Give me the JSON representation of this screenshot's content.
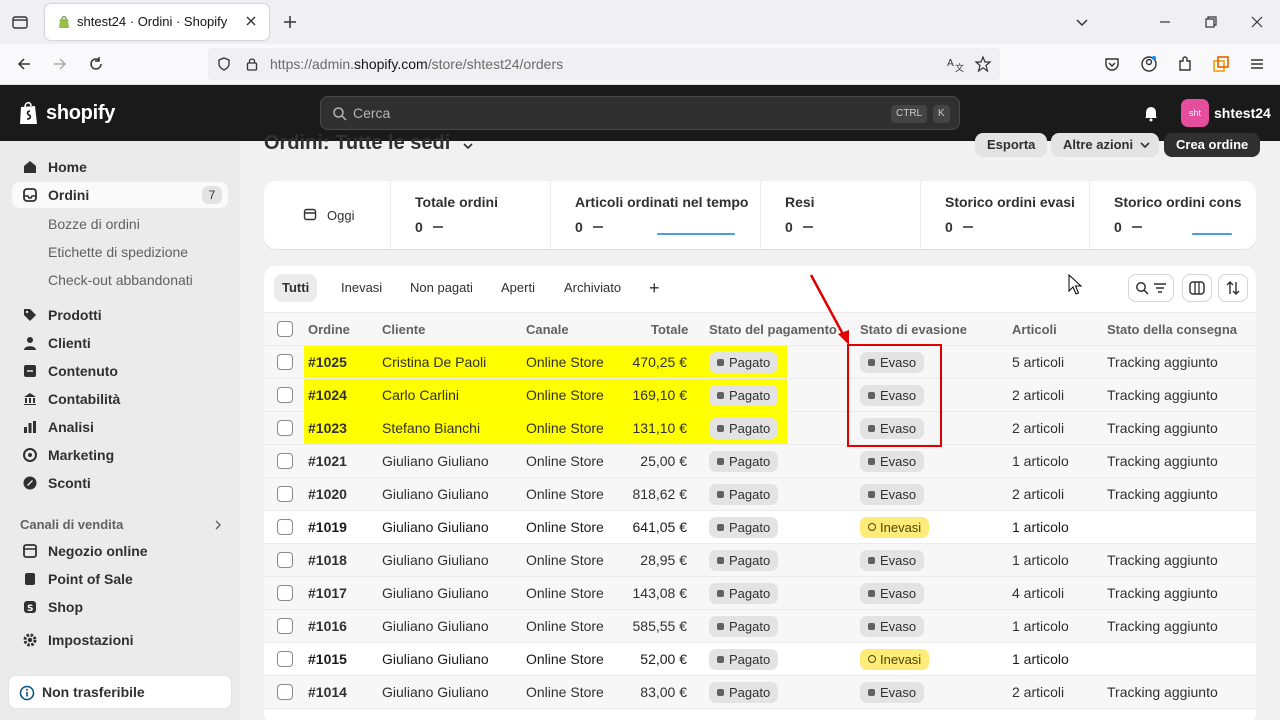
{
  "browser": {
    "tab_title": "shtest24 · Ordini · Shopify",
    "url_prefix": "https://admin.",
    "url_domain": "shopify.com",
    "url_path": "/store/shtest24/orders"
  },
  "topbar": {
    "logo_text": "shopify",
    "search_placeholder": "Cerca",
    "shortcut_1": "CTRL",
    "shortcut_2": "K",
    "store_badge": "sht",
    "store_name": "shtest24"
  },
  "sidebar": {
    "items": [
      {
        "label": "Home",
        "icon": "home-icon"
      },
      {
        "label": "Ordini",
        "icon": "orders-icon",
        "count": "7"
      },
      {
        "label": "Prodotti",
        "icon": "tag-icon"
      },
      {
        "label": "Clienti",
        "icon": "person-icon"
      },
      {
        "label": "Contenuto",
        "icon": "content-icon"
      },
      {
        "label": "Contabilità",
        "icon": "bank-icon"
      },
      {
        "label": "Analisi",
        "icon": "chart-icon"
      },
      {
        "label": "Marketing",
        "icon": "target-icon"
      },
      {
        "label": "Sconti",
        "icon": "discount-icon"
      }
    ],
    "sub_items": [
      "Bozze di ordini",
      "Etichette di spedizione",
      "Check-out abbandonati"
    ],
    "section_title": "Canali di vendita",
    "channels": [
      {
        "label": "Negozio online",
        "icon": "store-icon"
      },
      {
        "label": "Point of Sale",
        "icon": "pos-icon"
      },
      {
        "label": "Shop",
        "icon": "shop-icon"
      }
    ],
    "settings_label": "Impostazioni",
    "bottom_label": "Non trasferibile"
  },
  "page": {
    "title": "Ordini: Tutte le sedi",
    "export_label": "Esporta",
    "more_actions_label": "Altre azioni",
    "create_label": "Crea ordine"
  },
  "metrics": {
    "date_label": "Oggi",
    "items": [
      {
        "title": "Totale ordini",
        "value": "0"
      },
      {
        "title": "Articoli ordinati nel tempo",
        "value": "0"
      },
      {
        "title": "Resi",
        "value": "0"
      },
      {
        "title": "Storico ordini evasi",
        "value": "0"
      },
      {
        "title": "Storico ordini cons",
        "value": "0"
      }
    ]
  },
  "filters": {
    "tabs": [
      "Tutti",
      "Inevasi",
      "Non pagati",
      "Aperti",
      "Archiviato"
    ],
    "add": "+"
  },
  "table": {
    "headers": [
      "Ordine",
      "Cliente",
      "Canale",
      "Totale",
      "Stato del pagamento",
      "Stato di evasione",
      "Articoli",
      "Stato della consegna"
    ],
    "rows": [
      {
        "order": "#1025",
        "customer": "Cristina De Paoli",
        "channel": "Online Store",
        "total": "470,25 €",
        "payment": "Pagato",
        "fulfillment": "Evaso",
        "items": "5 articoli",
        "delivery": "Tracking aggiunto"
      },
      {
        "order": "#1024",
        "customer": "Carlo Carlini",
        "channel": "Online Store",
        "total": "169,10 €",
        "payment": "Pagato",
        "fulfillment": "Evaso",
        "items": "2 articoli",
        "delivery": "Tracking aggiunto"
      },
      {
        "order": "#1023",
        "customer": "Stefano Bianchi",
        "channel": "Online Store",
        "total": "131,10 €",
        "payment": "Pagato",
        "fulfillment": "Evaso",
        "items": "2 articoli",
        "delivery": "Tracking aggiunto"
      },
      {
        "order": "#1021",
        "customer": "Giuliano Giuliano",
        "channel": "Online Store",
        "total": "25,00 €",
        "payment": "Pagato",
        "fulfillment": "Evaso",
        "items": "1 articolo",
        "delivery": "Tracking aggiunto"
      },
      {
        "order": "#1020",
        "customer": "Giuliano Giuliano",
        "channel": "Online Store",
        "total": "818,62 €",
        "payment": "Pagato",
        "fulfillment": "Evaso",
        "items": "2 articoli",
        "delivery": "Tracking aggiunto"
      },
      {
        "order": "#1019",
        "customer": "Giuliano Giuliano",
        "channel": "Online Store",
        "total": "641,05 €",
        "payment": "Pagato",
        "fulfillment": "Inevasi",
        "items": "1 articolo",
        "delivery": ""
      },
      {
        "order": "#1018",
        "customer": "Giuliano Giuliano",
        "channel": "Online Store",
        "total": "28,95 €",
        "payment": "Pagato",
        "fulfillment": "Evaso",
        "items": "1 articolo",
        "delivery": "Tracking aggiunto"
      },
      {
        "order": "#1017",
        "customer": "Giuliano Giuliano",
        "channel": "Online Store",
        "total": "143,08 €",
        "payment": "Pagato",
        "fulfillment": "Evaso",
        "items": "4 articoli",
        "delivery": "Tracking aggiunto"
      },
      {
        "order": "#1016",
        "customer": "Giuliano Giuliano",
        "channel": "Online Store",
        "total": "585,55 €",
        "payment": "Pagato",
        "fulfillment": "Evaso",
        "items": "1 articolo",
        "delivery": "Tracking aggiunto"
      },
      {
        "order": "#1015",
        "customer": "Giuliano Giuliano",
        "channel": "Online Store",
        "total": "52,00 €",
        "payment": "Pagato",
        "fulfillment": "Inevasi",
        "items": "1 articolo",
        "delivery": ""
      },
      {
        "order": "#1014",
        "customer": "Giuliano Giuliano",
        "channel": "Online Store",
        "total": "83,00 €",
        "payment": "Pagato",
        "fulfillment": "Evaso",
        "items": "2 articoli",
        "delivery": "Tracking aggiunto"
      }
    ],
    "highlighted_rows": 3
  },
  "colors": {
    "highlight": "#ffff00",
    "annotation": "#e00000",
    "unfulfilled_badge": "#ffeb78",
    "topbar": "#1a1a1a"
  }
}
